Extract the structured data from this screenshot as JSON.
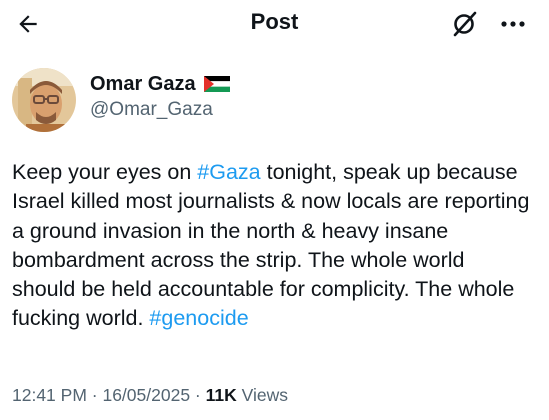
{
  "header": {
    "title": "Post",
    "back_icon": "arrow-left-icon",
    "grok_icon": "grok-icon",
    "more_icon": "more-options-icon"
  },
  "author": {
    "display_name": "Omar Gaza",
    "flag_icon": "palestine-flag-icon",
    "handle": "@Omar_Gaza"
  },
  "tweet": {
    "part1": "Keep your eyes on ",
    "hashtag1": "#Gaza",
    "part2": " tonight, speak up because Israel killed most journalists & now locals are reporting a ground invasion in the north & heavy insane bombardment across the strip. The whole world should be held accountable for complicity. The whole fucking world. ",
    "hashtag2": "#genocide"
  },
  "meta": {
    "time": "12:41 PM",
    "sep1": " · ",
    "date": "16/05/2025",
    "sep2": " · ",
    "views_count": "11K",
    "views_label": " Views"
  },
  "colors": {
    "link": "#1d9bf0",
    "text": "#0f1419",
    "secondary": "#536471",
    "flag_black": "#000000",
    "flag_white": "#ffffff",
    "flag_green": "#149954",
    "flag_red": "#e4312b"
  }
}
